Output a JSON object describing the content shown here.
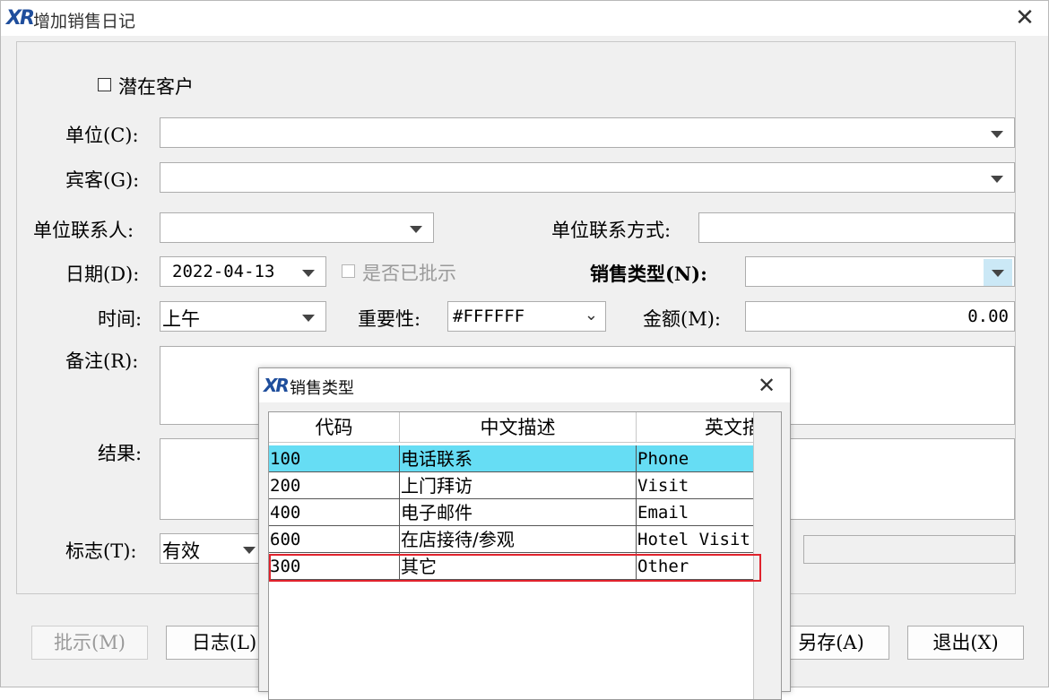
{
  "window": {
    "title": "增加销售日记"
  },
  "form": {
    "potential_customer": "潜在客户",
    "unit_label": "单位(C):",
    "unit_value": "",
    "guest_label": "宾客(G):",
    "guest_value": "",
    "contact_label": "单位联系人:",
    "contact_value": "",
    "contact_method_label": "单位联系方式:",
    "contact_method_value": "",
    "date_label": "日期(D):",
    "date_value": "2022-04-13",
    "approved_label": "是否已批示",
    "sales_type_label": "销售类型(N):",
    "sales_type_value": "",
    "time_label": "时间:",
    "time_value": "上午",
    "importance_label": "重要性:",
    "importance_value": "#FFFFFF",
    "amount_label": "金额(M):",
    "amount_value": "0.00",
    "remark_label": "备注(R):",
    "result_label": "结果:",
    "flag_label": "标志(T):",
    "flag_value": "有效"
  },
  "buttons": {
    "approve": "批示(M)",
    "log": "日志(L)",
    "save_as": "另存(A)",
    "exit": "退出(X)"
  },
  "popup": {
    "title": "销售类型",
    "columns": [
      "代码",
      "中文描述",
      "英文描"
    ],
    "rows": [
      {
        "code": "100",
        "cn": "电话联系",
        "en": "Phone"
      },
      {
        "code": "200",
        "cn": "上门拜访",
        "en": "Visit"
      },
      {
        "code": "400",
        "cn": "电子邮件",
        "en": "Email"
      },
      {
        "code": "600",
        "cn": "在店接待/参观",
        "en": "Hotel Visit"
      },
      {
        "code": "300",
        "cn": "其它",
        "en": "Other"
      }
    ],
    "selected_row": 0,
    "highlighted_row": 4
  },
  "colors": {
    "selection": "#66ddf4",
    "highlight_box": "#e0232d",
    "brand": "#1f4e9c"
  }
}
